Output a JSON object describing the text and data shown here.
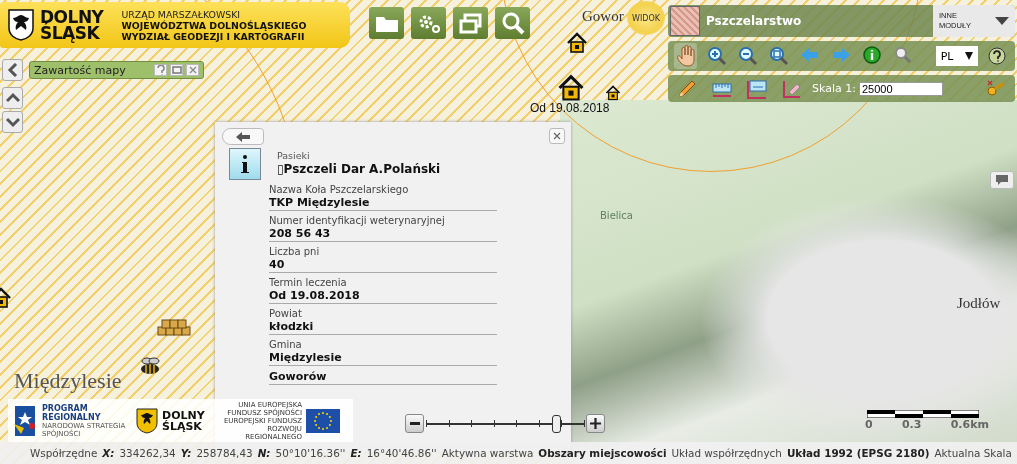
{
  "header": {
    "logo": [
      "DOLNY",
      "ŚLĄSK"
    ],
    "lines": [
      "URZĄD MARSZAŁKOWSKI",
      "WOJEWÓDZTWA DOLNOŚLĄSKIEGO",
      "WYDZIAŁ GEODEZJI I KARTOGRAFII"
    ]
  },
  "map_contents_panel": {
    "title": "Zawartość mapy"
  },
  "module": {
    "name": "Pszczelarstwo",
    "switcher": "INNE MODUŁY"
  },
  "tools": {
    "language": "PL",
    "scale_label": "Skala 1:",
    "scale_value": "25000"
  },
  "view_badge": "WIDOK",
  "map_labels": [
    {
      "text": "Gowor",
      "kind": "town"
    },
    {
      "text": "Od 19.08.2018",
      "kind": "date"
    },
    {
      "text": "Bielica",
      "kind": "faint"
    },
    {
      "text": "Jodłów",
      "kind": "town"
    },
    {
      "text": "Międzylesie",
      "kind": "big"
    }
  ],
  "popup": {
    "layer": "Pasieki",
    "title": "▯Pszczeli Dar A.Polański",
    "fields": [
      {
        "label": "Nazwa Koła Pszczelarskiego",
        "value": "TKP Międzylesie"
      },
      {
        "label": "Numer identyfikacji weterynaryjnej",
        "value": "208 56 43"
      },
      {
        "label": "Liczba pni",
        "value": "40"
      },
      {
        "label": "Termin leczenia",
        "value": "Od 19.08.2018"
      },
      {
        "label": "Powiat",
        "value": "kłodzki"
      },
      {
        "label": "Gmina",
        "value": "Międzylesie"
      },
      {
        "value": "Goworów"
      }
    ]
  },
  "logos": {
    "program": [
      "PROGRAM",
      "REGIONALNY",
      "NARODOWA STRATEGIA SPÓJNOŚCI"
    ],
    "region": [
      "DOLNY",
      "ŚLĄSK"
    ],
    "eu": [
      "UNIA EUROPEJSKA",
      "FUNDUSZ SPÓJNOŚCI",
      "EUROPEJSKI FUNDUSZ",
      "ROZWOJU REGIONALNEGO"
    ]
  },
  "zoom": {
    "level": 0.82
  },
  "scale_bar": [
    "0",
    "0.3",
    "0.6km"
  ],
  "status_bar": [
    {
      "text": "Współrzędne",
      "kind": "plain"
    },
    {
      "text": "X:",
      "kind": "key"
    },
    {
      "text": "334262,34",
      "kind": "plain"
    },
    {
      "text": "Y:",
      "kind": "key"
    },
    {
      "text": "258784,43",
      "kind": "plain"
    },
    {
      "text": "N:",
      "kind": "key"
    },
    {
      "text": "50°10'16.36''",
      "kind": "plain"
    },
    {
      "text": "E:",
      "kind": "key"
    },
    {
      "text": "16°40'46.86''",
      "kind": "plain"
    },
    {
      "text": "Aktywna warstwa",
      "kind": "plain"
    },
    {
      "text": "Obszary miejscowości",
      "kind": "bold"
    },
    {
      "text": "Układ współrzędnych",
      "kind": "plain"
    },
    {
      "text": "Układ 1992 (EPSG 2180)",
      "kind": "bold"
    },
    {
      "text": "Aktualna Skala",
      "kind": "plain"
    }
  ]
}
